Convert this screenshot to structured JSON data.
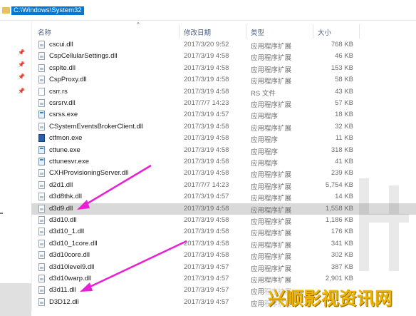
{
  "address_bar": {
    "path": "C:\\Windows\\System32"
  },
  "columns": {
    "name": "名称",
    "date": "修改日期",
    "type": "类型",
    "size": "大小"
  },
  "files": [
    {
      "name": "cscui.dll",
      "date": "2017/3/20 9:52",
      "type": "应用程序扩展",
      "size": "768 KB",
      "icon": "dll-file-icon"
    },
    {
      "name": "CspCellularSettings.dll",
      "date": "2017/3/19 4:58",
      "type": "应用程序扩展",
      "size": "46 KB",
      "icon": "dll-file-icon"
    },
    {
      "name": "csplte.dll",
      "date": "2017/3/19 4:58",
      "type": "应用程序扩展",
      "size": "153 KB",
      "icon": "dll-file-icon"
    },
    {
      "name": "CspProxy.dll",
      "date": "2017/3/19 4:58",
      "type": "应用程序扩展",
      "size": "58 KB",
      "icon": "dll-file-icon"
    },
    {
      "name": "csrr.rs",
      "date": "2017/3/19 4:58",
      "type": "RS 文件",
      "size": "43 KB",
      "icon": "rs-file-icon"
    },
    {
      "name": "csrsrv.dll",
      "date": "2017/7/7 14:23",
      "type": "应用程序扩展",
      "size": "57 KB",
      "icon": "dll-file-icon"
    },
    {
      "name": "csrss.exe",
      "date": "2017/3/19 4:57",
      "type": "应用程序",
      "size": "18 KB",
      "icon": "exe-file-icon"
    },
    {
      "name": "CSystemEventsBrokerClient.dll",
      "date": "2017/3/19 4:58",
      "type": "应用程序扩展",
      "size": "32 KB",
      "icon": "dll-file-icon"
    },
    {
      "name": "ctfmon.exe",
      "date": "2017/3/19 4:58",
      "type": "应用程序",
      "size": "11 KB",
      "icon": "ctfmon-icon"
    },
    {
      "name": "cttune.exe",
      "date": "2017/3/19 4:58",
      "type": "应用程序",
      "size": "318 KB",
      "icon": "exe-file-icon"
    },
    {
      "name": "cttunesvr.exe",
      "date": "2017/3/19 4:58",
      "type": "应用程序",
      "size": "41 KB",
      "icon": "exe-file-icon"
    },
    {
      "name": "CXHProvisioningServer.dll",
      "date": "2017/3/19 4:58",
      "type": "应用程序扩展",
      "size": "239 KB",
      "icon": "dll-file-icon"
    },
    {
      "name": "d2d1.dll",
      "date": "2017/7/7 14:23",
      "type": "应用程序扩展",
      "size": "5,754 KB",
      "icon": "dll-file-icon"
    },
    {
      "name": "d3d8thk.dll",
      "date": "2017/3/19 4:57",
      "type": "应用程序扩展",
      "size": "14 KB",
      "icon": "dll-file-icon"
    },
    {
      "name": "d3d9.dll",
      "date": "2017/3/19 4:58",
      "type": "应用程序扩展",
      "size": "1,558 KB",
      "icon": "dll-file-icon"
    },
    {
      "name": "d3d10.dll",
      "date": "2017/3/19 4:58",
      "type": "应用程序扩展",
      "size": "1,186 KB",
      "icon": "dll-file-icon"
    },
    {
      "name": "d3d10_1.dll",
      "date": "2017/3/19 4:58",
      "type": "应用程序扩展",
      "size": "176 KB",
      "icon": "dll-file-icon"
    },
    {
      "name": "d3d10_1core.dll",
      "date": "2017/3/19 4:58",
      "type": "应用程序扩展",
      "size": "341 KB",
      "icon": "dll-file-icon"
    },
    {
      "name": "d3d10core.dll",
      "date": "2017/3/19 4:58",
      "type": "应用程序扩展",
      "size": "302 KB",
      "icon": "dll-file-icon"
    },
    {
      "name": "d3d10level9.dll",
      "date": "2017/3/19 4:57",
      "type": "应用程序扩展",
      "size": "387 KB",
      "icon": "dll-file-icon"
    },
    {
      "name": "d3d10warp.dll",
      "date": "2017/3/19 4:57",
      "type": "应用程序扩展",
      "size": "2,901 KB",
      "icon": "dll-file-icon"
    },
    {
      "name": "d3d11.dll",
      "date": "2017/3/19 4:57",
      "type": "应用程序扩展",
      "size": "",
      "icon": "dll-file-icon"
    },
    {
      "name": "D3D12.dll",
      "date": "2017/3/19 4:57",
      "type": "应用程序扩展",
      "size": "",
      "icon": "dll-file-icon"
    }
  ],
  "watermark": "兴顺影视资讯网",
  "colors": {
    "selection": "#0078d7",
    "highlight_row": "#d9d9d9",
    "arrow": "#e91fd6",
    "header_text": "#4d6082"
  }
}
